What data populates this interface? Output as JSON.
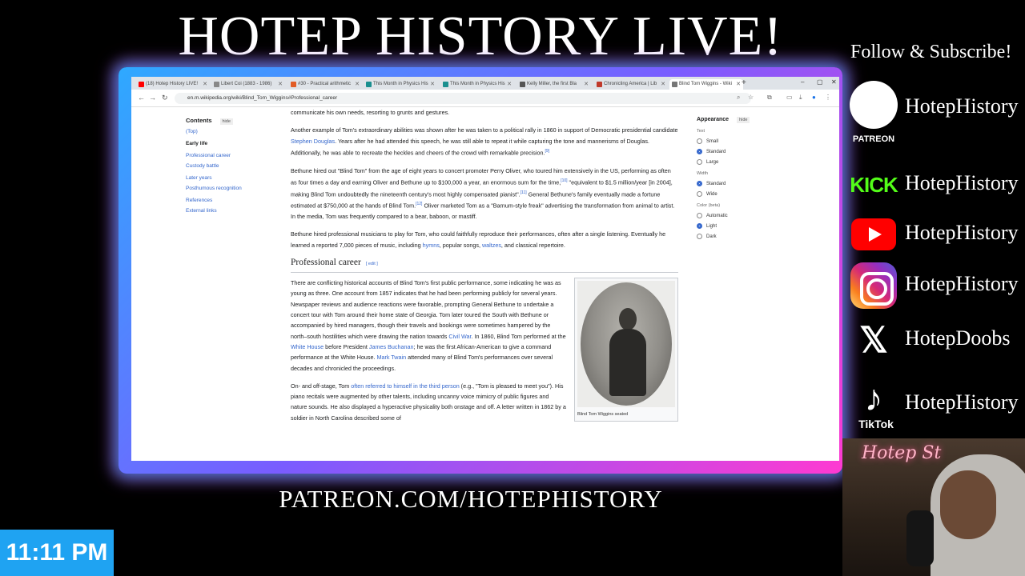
{
  "overlay": {
    "title": "HOTEP HISTORY LIVE!",
    "footer": "PATREON.COM/HOTEPHISTORY",
    "clock": "11:11 PM",
    "follow": "Follow & Subscribe!",
    "webcam_sign": "Hotep St",
    "socials": [
      {
        "platform": "PATREON",
        "handle": "HotepHistory"
      },
      {
        "platform": "KICK",
        "handle": "HotepHistory"
      },
      {
        "platform": "YouTube",
        "handle": "HotepHistory"
      },
      {
        "platform": "Instagram",
        "handle": "HotepHistory"
      },
      {
        "platform": "X",
        "handle": "HotepDoobs"
      },
      {
        "platform": "TikTok",
        "handle": "HotepHistory"
      }
    ]
  },
  "browser": {
    "tabs": [
      {
        "label": "(18) Hotep History LIVE!",
        "color": "#ff0000"
      },
      {
        "label": "Libert Coi (1883 - 1986)",
        "color": "#888888"
      },
      {
        "label": "#30 - Practical arithmetic",
        "color": "#e25c26"
      },
      {
        "label": "This Month in Physics His",
        "color": "#1a8f8f"
      },
      {
        "label": "This Month in Physics His",
        "color": "#1a8f8f"
      },
      {
        "label": "Kelly Miller, the first Bla",
        "color": "#555555"
      },
      {
        "label": "Chronicling America | Lib",
        "color": "#c0392b"
      },
      {
        "label": "Blind Tom Wiggins - Wiki",
        "color": "#777777"
      }
    ],
    "url": "en.m.wikipedia.org/wiki/Blind_Tom_Wiggins#Professional_career"
  },
  "toc": {
    "heading": "Contents",
    "hide": "hide",
    "items": [
      "(Top)",
      "Early life",
      "Professional career",
      "Custody battle",
      "Later years",
      "Posthumous recognition",
      "References",
      "External links"
    ]
  },
  "article": {
    "para0": "communicate his own needs, resorting to grunts and gestures.",
    "para1": {
      "a": "Another example of Tom's extraordinary abilities was shown after he was taken to a political rally in 1860 in support of Democratic presidential candidate ",
      "link": "Stephen Douglas",
      "b": ". Years after he had attended this speech, he was still able to repeat it while capturing the tone and mannerisms of Douglas. Additionally, he was able to recreate the heckles and cheers of the crowd with remarkable precision.",
      "ref": "[9]"
    },
    "para2": {
      "a": "Bethune hired out \"Blind Tom\" from the age of eight years to concert promoter Perry Oliver, who toured him extensively in the US, performing as often as four times a day and earning Oliver and Bethune up to $100,000 a year, an enormous sum for the time,",
      "ref1": "[10]",
      "b": " \"equivalent to $1.5 million/year [in 2004], making Blind Tom undoubtedly the nineteenth century's most highly compensated pianist\".",
      "ref2": "[11]",
      "c": " General Bethune's family eventually made a fortune estimated at $750,000 at the hands of Blind Tom.",
      "ref3": "[12]",
      "d": " Oliver marketed Tom as a \"Barnum-style freak\" advertising the transformation from animal to artist. In the media, Tom was frequently compared to a bear, baboon, or mastiff."
    },
    "para3": {
      "a": "Bethune hired professional musicians to play for Tom, who could faithfully reproduce their performances, often after a single listening. Eventually he learned a reported 7,000 pieces of music, including ",
      "link1": "hymns",
      "b": ", popular songs, ",
      "link2": "waltzes",
      "c": ", and classical repertoire."
    },
    "section": {
      "heading": "Professional career",
      "edit": "[ edit ]"
    },
    "career1": {
      "a": "There are conflicting historical accounts of Blind Tom's first public performance, some indicating he was as young as three. One account from 1857 indicates that he had been performing publicly for several years. Newspaper reviews and audience reactions were favorable, prompting General Bethune to undertake a concert tour with Tom around their home state of Georgia. Tom later toured the South with Bethune or accompanied by hired managers, though their travels and bookings were sometimes hampered by the north–south hostilities which were drawing the nation towards ",
      "link1": "Civil War",
      "b": ". In 1860, Blind Tom performed at the ",
      "link2": "White House",
      "c": " before President ",
      "link3": "James Buchanan",
      "d": "; he was the first African-American to give a command performance at the White House. ",
      "link4": "Mark Twain",
      "e": " attended many of Blind Tom's performances over several decades and chronicled the proceedings."
    },
    "career2": {
      "a": "On- and off-stage, Tom ",
      "link": "often referred to himself in the third person",
      "b": " (e.g., \"Tom is pleased to meet you\"). His piano recitals were augmented by other talents, including uncanny voice mimicry of public figures and nature sounds. He also displayed a hyperactive physicality both onstage and off. A letter written in 1862 by a soldier in North Carolina described some of"
    },
    "caption": "Blind Tom Wiggins seated"
  },
  "appearance": {
    "heading": "Appearance",
    "hide": "hide",
    "text_label": "Text",
    "text_options": [
      "Small",
      "Standard",
      "Large"
    ],
    "text_selected": "Standard",
    "width_label": "Width",
    "width_options": [
      "Standard",
      "Wide"
    ],
    "width_selected": "Standard",
    "color_label": "Color (beta)",
    "color_options": [
      "Automatic",
      "Light",
      "Dark"
    ],
    "color_selected": "Light"
  },
  "colors": {
    "clock_bg": "#1fa3f2",
    "link": "#3366cc",
    "kick_green": "#53fc18",
    "youtube_red": "#ff0000"
  }
}
